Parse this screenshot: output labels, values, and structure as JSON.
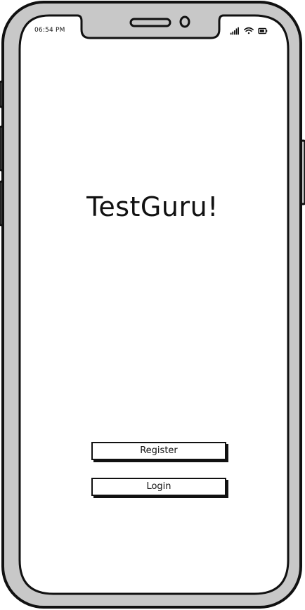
{
  "status_bar": {
    "time": "06:54 PM",
    "icons": [
      "signal-icon",
      "wifi-icon",
      "battery-icon"
    ]
  },
  "main": {
    "title": "TestGuru!"
  },
  "actions": {
    "register_label": "Register",
    "login_label": "Login"
  },
  "colors": {
    "frame_gray": "#c8c8c8",
    "ink": "#111111",
    "screen": "#ffffff"
  }
}
